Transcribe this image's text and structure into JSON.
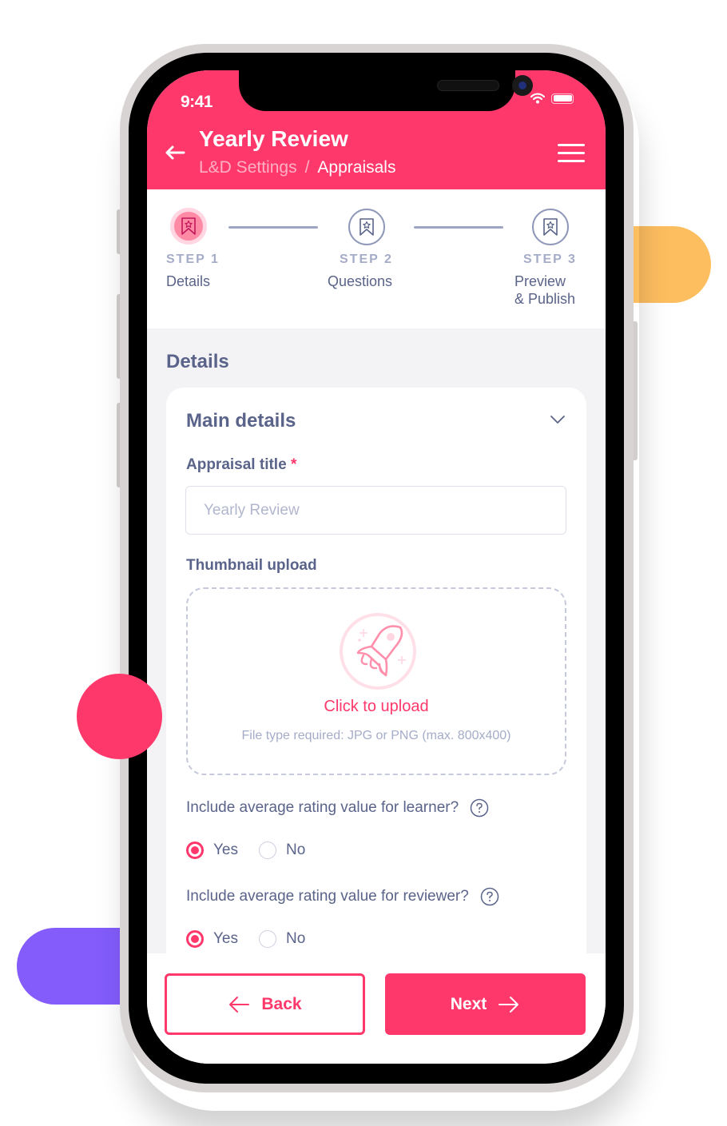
{
  "status_bar": {
    "time": "9:41"
  },
  "header": {
    "title": "Yearly Review",
    "breadcrumb": {
      "parent": "L&D Settings",
      "separator": "/",
      "current": "Appraisals"
    }
  },
  "stepper": {
    "steps": [
      {
        "label": "STEP 1",
        "name": "Details",
        "state": "active"
      },
      {
        "label": "STEP 2",
        "name": "Questions",
        "state": "inactive"
      },
      {
        "label": "STEP 3",
        "name": "Preview",
        "name_line2": "& Publish",
        "state": "inactive"
      }
    ]
  },
  "content": {
    "section_title": "Details",
    "card": {
      "title": "Main details",
      "appraisal_title": {
        "label": "Appraisal title",
        "required_marker": "*",
        "value": "",
        "placeholder": "Yearly Review"
      },
      "thumbnail": {
        "label": "Thumbnail upload",
        "cta": "Click to upload",
        "hint": "File type required: JPG or PNG (max. 800x400)"
      },
      "questions": [
        {
          "text": "Include average rating value for learner?",
          "options": [
            "Yes",
            "No"
          ],
          "selected": "Yes"
        },
        {
          "text": "Include average rating value for reviewer?",
          "options": [
            "Yes",
            "No"
          ],
          "selected": "Yes"
        }
      ]
    }
  },
  "footer": {
    "back_label": "Back",
    "next_label": "Next"
  },
  "colors": {
    "brand": "#ff386b",
    "text": "#5a6389",
    "muted": "#a5acc8",
    "accent_yellow": "#fdbe5f",
    "accent_purple": "#835cfb"
  }
}
